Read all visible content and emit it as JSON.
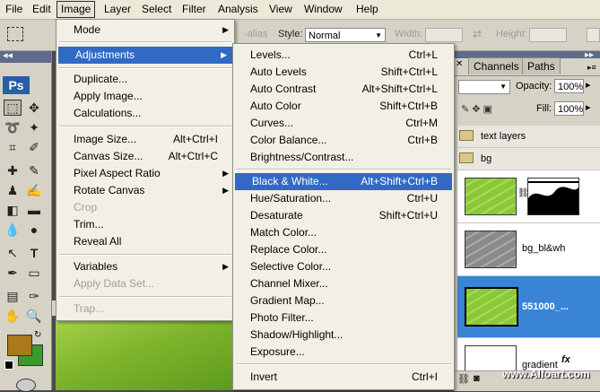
{
  "menubar": {
    "items": [
      "File",
      "Edit",
      "Image",
      "Layer",
      "Select",
      "Filter",
      "Analysis",
      "View",
      "Window",
      "Help"
    ]
  },
  "options": {
    "style_label": "Style:",
    "style_value": "Normal",
    "width_label": "Width:",
    "height_label": "Height:",
    "antialias_label": "-alias"
  },
  "toolbox": {
    "logo": "Ps"
  },
  "image_menu": {
    "items": [
      {
        "label": "Mode",
        "submenu": true
      },
      {
        "label": "Adjustments",
        "submenu": true,
        "highlighted": true
      },
      {
        "label": "Duplicate..."
      },
      {
        "label": "Apply Image..."
      },
      {
        "label": "Calculations..."
      },
      {
        "label": "Image Size...",
        "shortcut": "Alt+Ctrl+I"
      },
      {
        "label": "Canvas Size...",
        "shortcut": "Alt+Ctrl+C"
      },
      {
        "label": "Pixel Aspect Ratio",
        "submenu": true
      },
      {
        "label": "Rotate Canvas",
        "submenu": true
      },
      {
        "label": "Crop",
        "disabled": true
      },
      {
        "label": "Trim..."
      },
      {
        "label": "Reveal All"
      },
      {
        "label": "Variables",
        "submenu": true
      },
      {
        "label": "Apply Data Set...",
        "disabled": true
      },
      {
        "label": "Trap...",
        "disabled": true
      }
    ]
  },
  "adjust_menu": {
    "items": [
      {
        "label": "Levels...",
        "shortcut": "Ctrl+L"
      },
      {
        "label": "Auto Levels",
        "shortcut": "Shift+Ctrl+L"
      },
      {
        "label": "Auto Contrast",
        "shortcut": "Alt+Shift+Ctrl+L"
      },
      {
        "label": "Auto Color",
        "shortcut": "Shift+Ctrl+B"
      },
      {
        "label": "Curves...",
        "shortcut": "Ctrl+M"
      },
      {
        "label": "Color Balance...",
        "shortcut": "Ctrl+B"
      },
      {
        "label": "Brightness/Contrast..."
      },
      {
        "label": "Black & White...",
        "shortcut": "Alt+Shift+Ctrl+B",
        "highlighted": true
      },
      {
        "label": "Hue/Saturation...",
        "shortcut": "Ctrl+U"
      },
      {
        "label": "Desaturate",
        "shortcut": "Shift+Ctrl+U"
      },
      {
        "label": "Match Color..."
      },
      {
        "label": "Replace Color..."
      },
      {
        "label": "Selective Color..."
      },
      {
        "label": "Channel Mixer..."
      },
      {
        "label": "Gradient Map..."
      },
      {
        "label": "Photo Filter..."
      },
      {
        "label": "Shadow/Highlight..."
      },
      {
        "label": "Exposure..."
      },
      {
        "label": "Invert",
        "shortcut": "Ctrl+I"
      }
    ]
  },
  "layers_panel": {
    "tabs": [
      "Channels",
      "Paths"
    ],
    "opacity_label": "Opacity:",
    "opacity_value": "100%",
    "fill_label": "Fill:",
    "fill_value": "100%",
    "groups": [
      "text layers",
      "bg"
    ],
    "layers": [
      {
        "name": ""
      },
      {
        "name": "bg_bl&wh"
      },
      {
        "name": "551000_..."
      },
      {
        "name": "gradient"
      }
    ]
  },
  "watermark": "www.Alfoart.com",
  "colors": {
    "highlight": "#316ac5",
    "layer_selected": "#3a84d6",
    "foreground": "#a87a1a",
    "background": "#3a9a2a"
  }
}
